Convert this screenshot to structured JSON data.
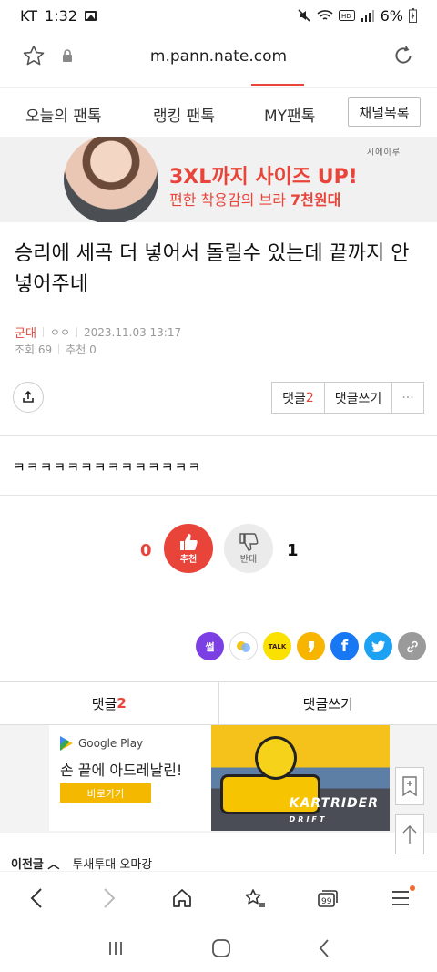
{
  "status": {
    "carrier": "KT",
    "time": "1:32",
    "battery": "6%"
  },
  "browser": {
    "url": "m.pann.nate.com"
  },
  "nav": {
    "tabs": [
      "오늘의 팬톡",
      "랭킹 팬톡",
      "MY팬톡"
    ],
    "channel_btn": "채널목록"
  },
  "ad_top": {
    "brand": "시에이루",
    "title": "3XL까지 사이즈 UP!",
    "sub_prefix": "편한 착용감의 브라 ",
    "sub_bold": "7천원대"
  },
  "post": {
    "title": "승리에 세곡 더 넣어서 돌릴수 있는데 끝까지 안 넣어주네",
    "category": "군대",
    "author": "ㅇㅇ",
    "date": "2023.11.03 13:17",
    "views": "조회 69",
    "recommend": "추천 0",
    "body": "ㅋㅋㅋㅋㅋㅋㅋㅋㅋㅋㅋㅋㅋㅋ"
  },
  "actions": {
    "comment_label": "댓글",
    "comment_count": "2",
    "write_comment": "댓글쓰기",
    "more": "···"
  },
  "vote": {
    "up_count": "0",
    "up_label": "추천",
    "down_label": "반대",
    "down_count": "1"
  },
  "sns": [
    {
      "name": "ssul-share",
      "label": "썰",
      "color": "#7b3fe4"
    },
    {
      "name": "chat-share",
      "label": "",
      "color": "#ffffff"
    },
    {
      "name": "kakaotalk-share",
      "label": "TALK",
      "color": "#fae100"
    },
    {
      "name": "kakaostory-share",
      "label": "",
      "color": "#f7b500"
    },
    {
      "name": "facebook-share",
      "label": "f",
      "color": "#1877f2"
    },
    {
      "name": "twitter-share",
      "label": "",
      "color": "#1da1f2"
    },
    {
      "name": "link-share",
      "label": "",
      "color": "#9a9a9a"
    }
  ],
  "comment_bar": {
    "comments_label": "댓글",
    "comments_count": "2",
    "write_label": "댓글쓰기"
  },
  "ad_bottom": {
    "store": "Google Play",
    "headline": "손 끝에 아드레날린!",
    "button": "바로가기",
    "game_title": "KARTRIDER",
    "game_sub": "DRIFT"
  },
  "prev": {
    "label": "이전글 ︿",
    "title": "투새투대 오마강"
  }
}
